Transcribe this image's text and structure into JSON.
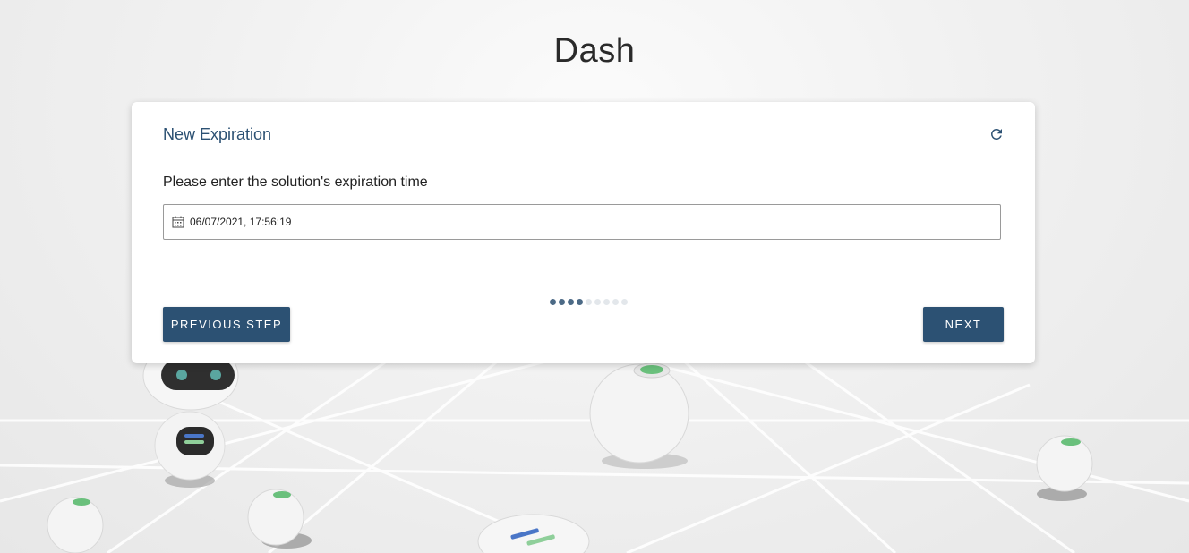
{
  "app": {
    "title": "Dash"
  },
  "card": {
    "title": "New Expiration",
    "refresh_icon": "refresh-icon",
    "prompt": "Please enter the solution's expiration time",
    "date_input": {
      "value": "06/07/2021, 17:56:19",
      "icon": "calendar-icon"
    },
    "stepper": {
      "total_steps": 9,
      "completed_steps": 4
    },
    "previous_label": "PREVIOUS STEP",
    "next_label": "NEXT"
  },
  "colors": {
    "accent": "#2c5173",
    "step_active": "#4c6a86",
    "step_inactive": "#e3e7eb"
  }
}
